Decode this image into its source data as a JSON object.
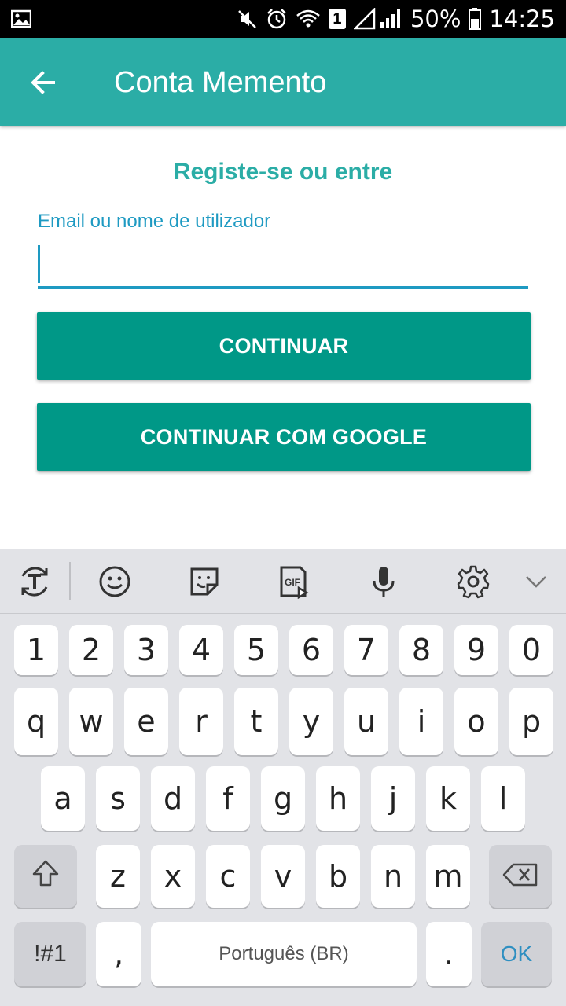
{
  "status_bar": {
    "battery": "50%",
    "time": "14:25",
    "sim_badge": "1",
    "icons": [
      "image-icon",
      "mute-icon",
      "alarm-icon",
      "wifi-icon",
      "sim-icon",
      "signal-icon",
      "battery-icon"
    ]
  },
  "app_bar": {
    "title": "Conta Memento",
    "back_icon": "arrow-left-icon",
    "color": "#2bada6"
  },
  "form": {
    "heading": "Registe-se ou entre",
    "email_label": "Email ou nome de utilizador",
    "email_value": "",
    "continue_label": "CONTINUAR",
    "google_label": "CONTINUAR COM GOOGLE",
    "button_color": "#009887",
    "accent_color": "#1e9ac2"
  },
  "keyboard": {
    "toolbar_icons": [
      "text-mode-icon",
      "emoji-icon",
      "sticker-icon",
      "gif-icon",
      "microphone-icon",
      "settings-icon",
      "chevron-down-icon"
    ],
    "gif_label": "GIF",
    "row_numbers": [
      "1",
      "2",
      "3",
      "4",
      "5",
      "6",
      "7",
      "8",
      "9",
      "0"
    ],
    "row_top": [
      "q",
      "w",
      "e",
      "r",
      "t",
      "y",
      "u",
      "i",
      "o",
      "p"
    ],
    "row_middle": [
      "a",
      "s",
      "d",
      "f",
      "g",
      "h",
      "j",
      "k",
      "l"
    ],
    "row_bottom": [
      "z",
      "x",
      "c",
      "v",
      "b",
      "n",
      "m"
    ],
    "symbols_key": "!#1",
    "comma_key": ",",
    "space_label": "Português (BR)",
    "period_key": ".",
    "ok_key": "OK"
  }
}
